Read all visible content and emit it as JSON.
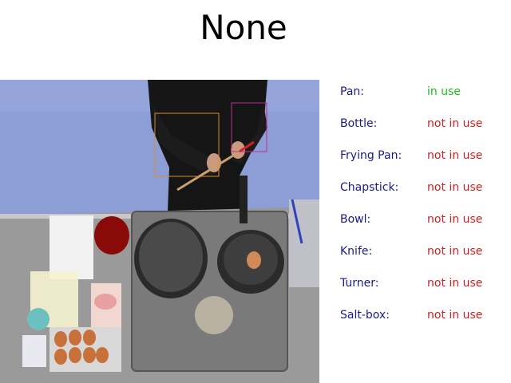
{
  "title": "None",
  "colors": {
    "label": "#1a1a8c",
    "in_use": "#22bb22",
    "not_in_use": "#cc2222",
    "box_orange": "#e08a30",
    "box_magenta": "#c0308a"
  },
  "objects": [
    {
      "label": "Pan:",
      "status": "in use",
      "in_use": true
    },
    {
      "label": "Bottle:",
      "status": "not in use",
      "in_use": false
    },
    {
      "label": "Frying Pan:",
      "status": "not in use",
      "in_use": false
    },
    {
      "label": "Chapstick:",
      "status": "not in use",
      "in_use": false
    },
    {
      "label": "Bowl:",
      "status": "not in use",
      "in_use": false
    },
    {
      "label": "Knife:",
      "status": "not in use",
      "in_use": false
    },
    {
      "label": "Turner:",
      "status": "not in use",
      "in_use": false
    },
    {
      "label": "Salt-box:",
      "status": "not in use",
      "in_use": false
    }
  ]
}
